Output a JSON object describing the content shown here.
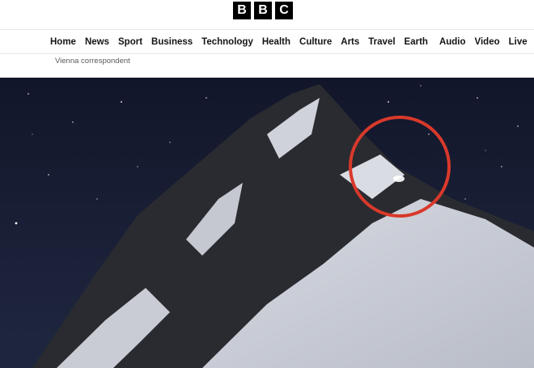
{
  "brand": {
    "letters": [
      "B",
      "B",
      "C"
    ]
  },
  "nav": {
    "items": [
      "Home",
      "News",
      "Sport",
      "Business",
      "Technology",
      "Health",
      "Culture",
      "Arts",
      "Travel",
      "Earth",
      "Audio",
      "Video",
      "Live"
    ]
  },
  "article": {
    "byline_role": "Vienna correspondent"
  },
  "image": {
    "subject": "night-time snowy mountain peak under starry sky with a red circle highlighting a light on the ridge",
    "highlight_color": "#d9392b"
  }
}
